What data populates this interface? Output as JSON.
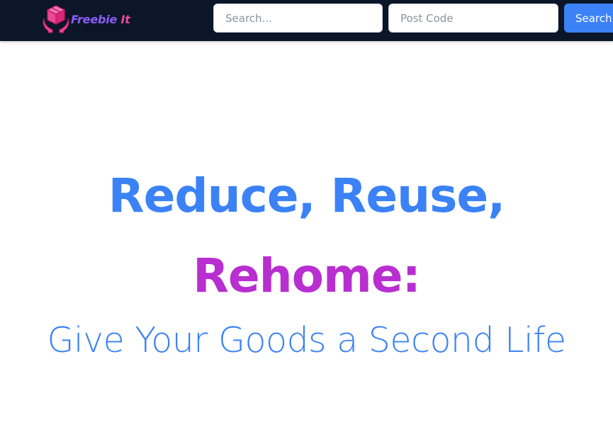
{
  "header": {
    "brand": {
      "name_part1": "Freebie",
      "name_part2": "It",
      "logo_icon": "box-in-hands-icon"
    },
    "search": {
      "placeholder": "Search..."
    },
    "postcode": {
      "placeholder": "Post Code"
    },
    "search_button_label": "Search"
  },
  "hero": {
    "line1": "Reduce, Reuse,",
    "line2": "Rehome:",
    "subtitle": "Give Your Goods a Second Life"
  },
  "colors": {
    "nav_background": "#0b1628",
    "accent_blue": "#3b82f6",
    "accent_magenta": "#b82ed0",
    "brand_pink": "#ec4899",
    "brand_purple": "#8b5cf6"
  }
}
